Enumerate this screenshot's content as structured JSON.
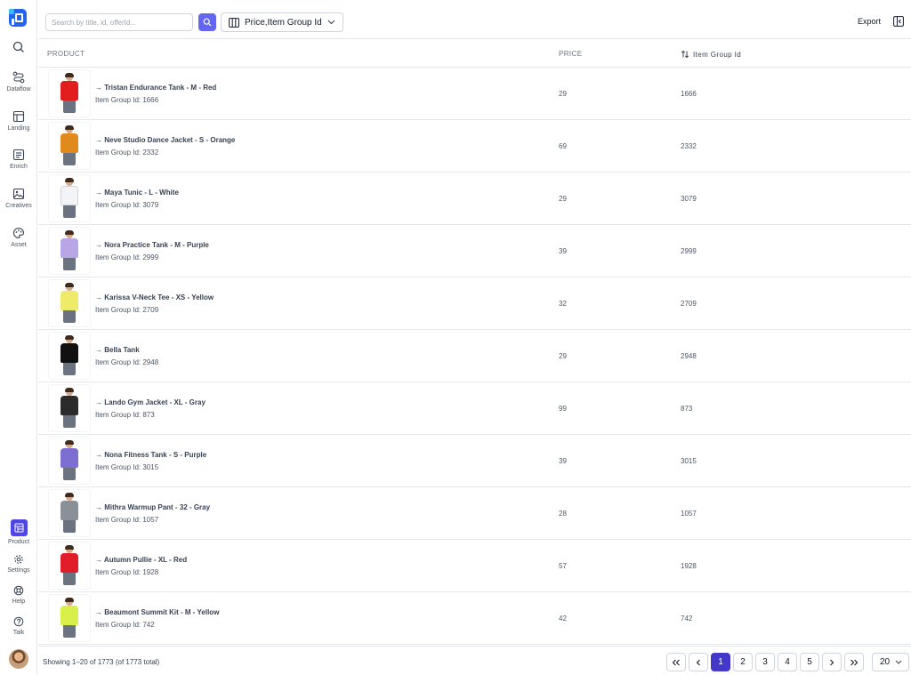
{
  "sidebar": {
    "nav": [
      {
        "id": "search",
        "label": "",
        "icon": "search-icon"
      },
      {
        "id": "dataflow",
        "label": "Dataflow",
        "icon": "dataflow-icon"
      },
      {
        "id": "landing",
        "label": "Landing",
        "icon": "layout-icon"
      },
      {
        "id": "enrich",
        "label": "Enrich",
        "icon": "document-text-icon"
      },
      {
        "id": "creatives",
        "label": "Creatives",
        "icon": "image-icon"
      },
      {
        "id": "asset",
        "label": "Asset",
        "icon": "palette-icon"
      }
    ],
    "bottom": [
      {
        "id": "product",
        "label": "Product",
        "icon": "table-icon",
        "active": true
      },
      {
        "id": "settings",
        "label": "Settings",
        "icon": "gear-icon"
      },
      {
        "id": "help",
        "label": "Help",
        "icon": "lifebuoy-icon"
      },
      {
        "id": "talk",
        "label": "Talk",
        "icon": "question-icon"
      }
    ]
  },
  "toolbar": {
    "search_placeholder": "Search by title, id, offerId...",
    "columns_label": "Price,Item Group Id",
    "export_label": "Export"
  },
  "table": {
    "headers": {
      "product": "PRODUCT",
      "price": "PRICE",
      "group": "Item Group Id"
    },
    "rows": [
      {
        "title": "→ Tristan Endurance Tank - M - Red",
        "sub": "Item Group Id: 1666",
        "price": "29",
        "group": "1666",
        "color": "#e11d1d"
      },
      {
        "title": "→ Neve Studio Dance Jacket - S - Orange",
        "sub": "Item Group Id: 2332",
        "price": "69",
        "group": "2332",
        "color": "#e08a1e"
      },
      {
        "title": "→ Maya Tunic - L - White",
        "sub": "Item Group Id: 3079",
        "price": "29",
        "group": "3079",
        "color": "#f3f4f6"
      },
      {
        "title": "→ Nora Practice Tank - M - Purple",
        "sub": "Item Group Id: 2999",
        "price": "39",
        "group": "2999",
        "color": "#b8a6e6"
      },
      {
        "title": "→ Karissa V-Neck Tee - XS - Yellow",
        "sub": "Item Group Id: 2709",
        "price": "32",
        "group": "2709",
        "color": "#eeea6a"
      },
      {
        "title": "→ Bella Tank",
        "sub": "Item Group Id: 2948",
        "price": "29",
        "group": "2948",
        "color": "#111111"
      },
      {
        "title": "→ Lando Gym Jacket - XL - Gray",
        "sub": "Item Group Id: 873",
        "price": "99",
        "group": "873",
        "color": "#2b2b2b"
      },
      {
        "title": "→ Nona Fitness Tank - S - Purple",
        "sub": "Item Group Id: 3015",
        "price": "39",
        "group": "3015",
        "color": "#7c6fd1"
      },
      {
        "title": "→ Mithra Warmup Pant - 32 - Gray",
        "sub": "Item Group Id: 1057",
        "price": "28",
        "group": "1057",
        "color": "#8b8f97"
      },
      {
        "title": "→ Autumn Pullie - XL - Red",
        "sub": "Item Group Id: 1928",
        "price": "57",
        "group": "1928",
        "color": "#e11d2a"
      },
      {
        "title": "→ Beaumont Summit Kit - M - Yellow",
        "sub": "Item Group Id: 742",
        "price": "42",
        "group": "742",
        "color": "#d9f04a"
      }
    ]
  },
  "footer": {
    "showing": "Showing 1–20 of 1773 (of 1773 total)",
    "pages": [
      "1",
      "2",
      "3",
      "4",
      "5"
    ],
    "current_page": "1",
    "page_size": "20"
  },
  "colors": {
    "accent": "#4f46e5",
    "search_button": "#6366f1",
    "border": "#e5e7eb"
  }
}
